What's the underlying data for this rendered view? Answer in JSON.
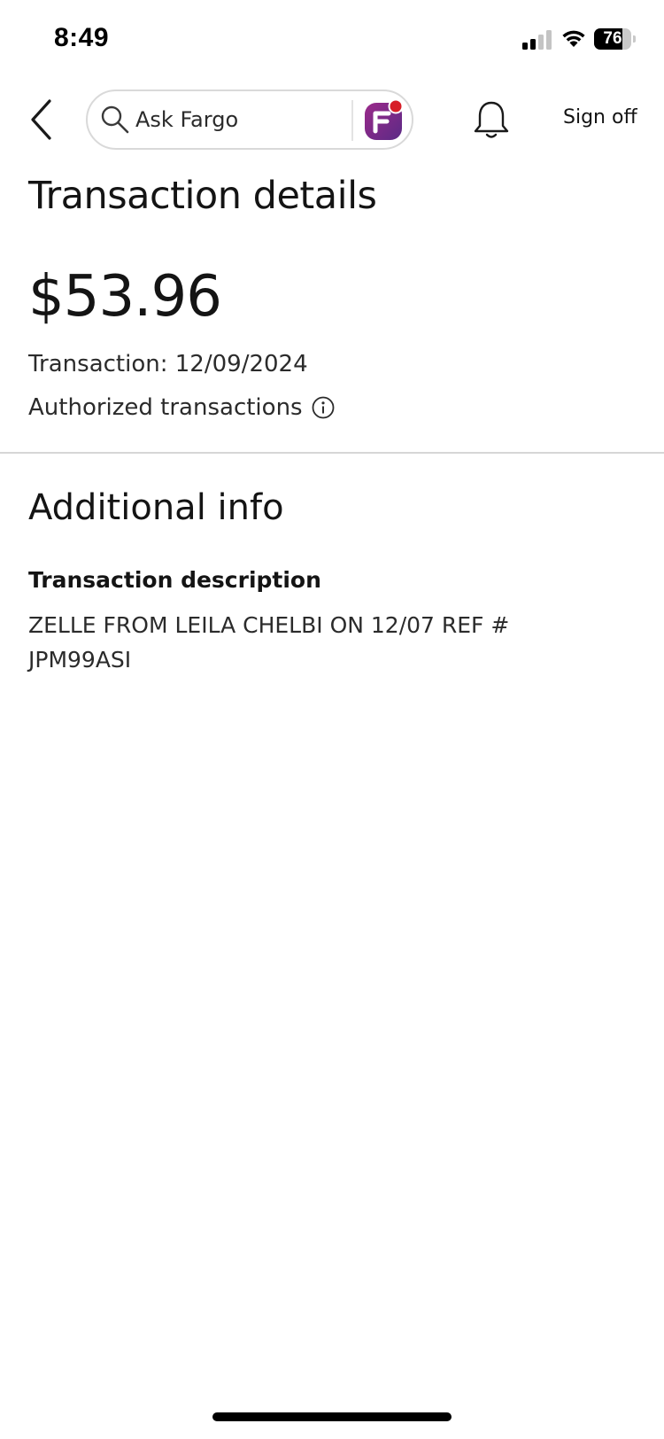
{
  "status_bar": {
    "time": "8:49",
    "battery_level": "76",
    "battery_fraction": 0.76,
    "signal_bars_active": 2,
    "signal_bars_total": 4,
    "icons": [
      "signal-icon",
      "wifi-icon",
      "battery-icon"
    ]
  },
  "nav": {
    "back_icon": "chevron-left-icon",
    "search_placeholder": "Ask Fargo",
    "fargo_icon": "fargo-chat-icon",
    "notifications_icon": "bell-icon",
    "sign_off_label": "Sign off"
  },
  "page": {
    "title": "Transaction details"
  },
  "transaction": {
    "amount": "$53.96",
    "date_line": "Transaction: 12/09/2024",
    "status_label": "Authorized transactions",
    "status_info_icon": "info-icon"
  },
  "additional_info": {
    "title": "Additional info",
    "description_label": "Transaction description",
    "description_value": "ZELLE FROM LEILA CHELBI ON 12/07 REF # JPM99ASI"
  },
  "colors": {
    "text": "#141414",
    "divider": "#d6d6d6",
    "fargo_purple": "#6b2c8f",
    "fargo_magenta": "#9b2a8a",
    "notification_dot": "#d71e28"
  }
}
